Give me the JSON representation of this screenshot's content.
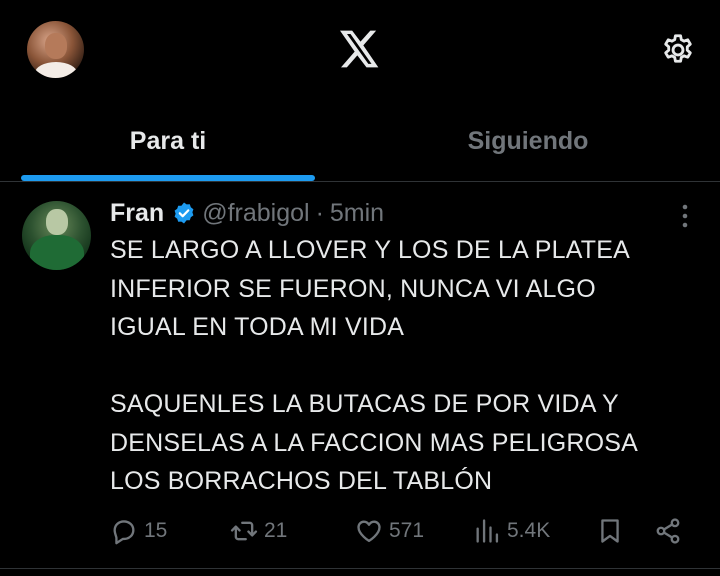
{
  "header": {
    "logo_icon": "x-logo-icon",
    "settings_icon": "gear-icon"
  },
  "tabs": [
    {
      "label": "Para ti",
      "active": true
    },
    {
      "label": "Siguiendo",
      "active": false
    }
  ],
  "accent_color": "#1d9bf0",
  "tweet": {
    "author_name": "Fran",
    "handle": "@frabigol",
    "separator": "·",
    "time": "5min",
    "verified": true,
    "text": "SE LARGO A LLOVER Y LOS DE LA PLATEA\nINFERIOR SE FUERON, NUNCA VI ALGO\nIGUAL EN TODA MI VIDA\n\nSAQUENLES LA BUTACAS DE POR VIDA Y\nDENSELAS A LA FACCION MAS PELIGROSA\nLOS BORRACHOS DEL TABLÓN",
    "replies": "15",
    "retweets": "21",
    "likes": "571",
    "views": "5.4K"
  }
}
